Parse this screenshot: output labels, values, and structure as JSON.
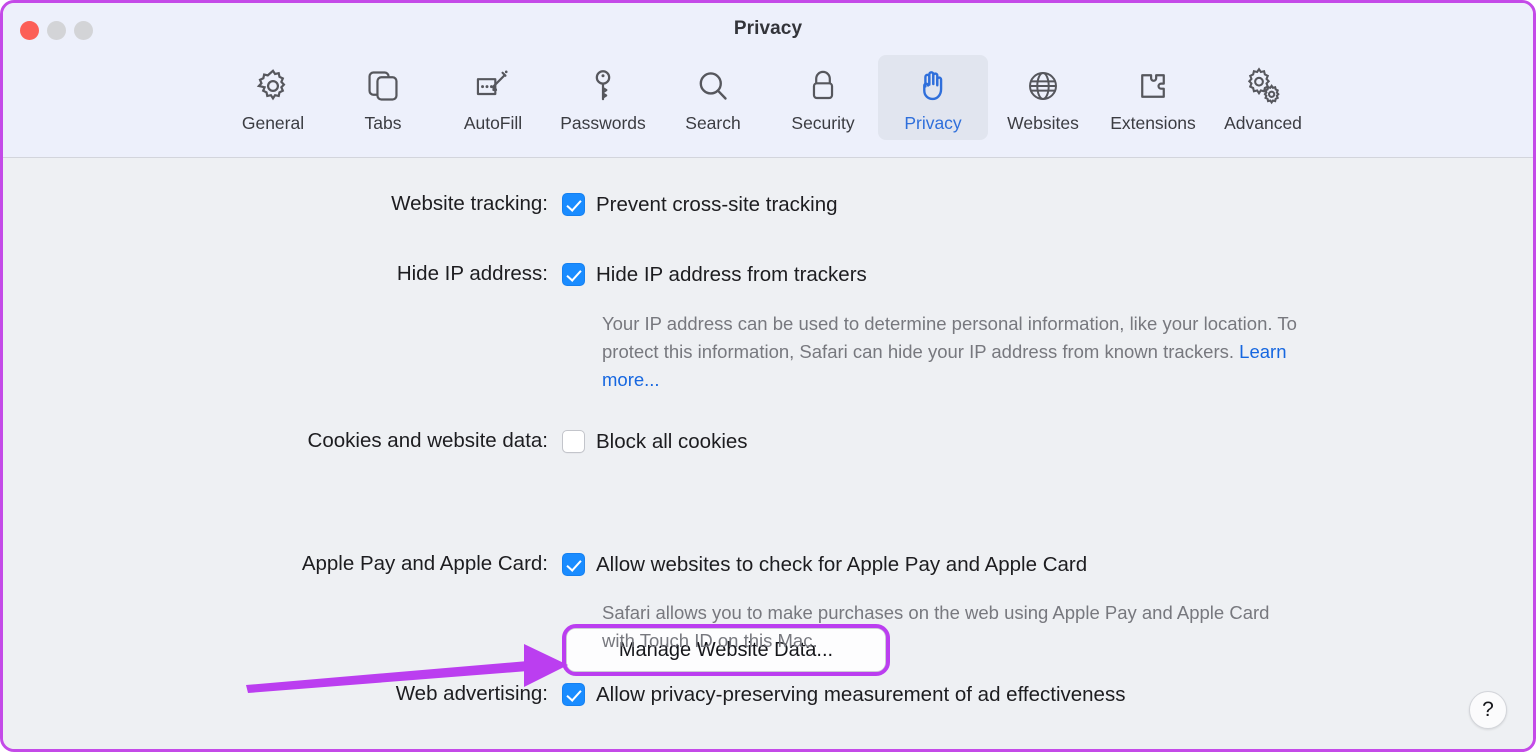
{
  "window": {
    "title": "Privacy",
    "traffic_lights": [
      {
        "name": "close",
        "color": "#fc5f57"
      },
      {
        "name": "minimize",
        "color": "#d3d4d7"
      },
      {
        "name": "zoom",
        "color": "#d3d4d7"
      }
    ],
    "highlight_color": "#c44ae8"
  },
  "toolbar": {
    "tabs": [
      {
        "label": "General",
        "icon": "gear-icon",
        "selected": false
      },
      {
        "label": "Tabs",
        "icon": "tabs-icon",
        "selected": false
      },
      {
        "label": "AutoFill",
        "icon": "autofill-icon",
        "selected": false
      },
      {
        "label": "Passwords",
        "icon": "key-icon",
        "selected": false
      },
      {
        "label": "Search",
        "icon": "search-icon",
        "selected": false
      },
      {
        "label": "Security",
        "icon": "lock-icon",
        "selected": false
      },
      {
        "label": "Privacy",
        "icon": "hand-icon",
        "selected": true
      },
      {
        "label": "Websites",
        "icon": "globe-icon",
        "selected": false
      },
      {
        "label": "Extensions",
        "icon": "puzzle-icon",
        "selected": false
      },
      {
        "label": "Advanced",
        "icon": "gears-icon",
        "selected": false
      }
    ],
    "selected_tab": "Privacy",
    "accent_color": "#2f6fdb"
  },
  "settings": {
    "website_tracking": {
      "label": "Website tracking:",
      "checkbox_label": "Prevent cross-site tracking",
      "checked": true
    },
    "hide_ip": {
      "label": "Hide IP address:",
      "checkbox_label": "Hide IP address from trackers",
      "checked": true,
      "description": "Your IP address can be used to determine personal information, like your location. To protect this information, Safari can hide your IP address from known trackers. ",
      "link_text": "Learn more..."
    },
    "cookies": {
      "label": "Cookies and website data:",
      "checkbox_label": "Block all cookies",
      "checked": false,
      "button_label": "Manage Website Data..."
    },
    "apple_pay": {
      "label": "Apple Pay and Apple Card:",
      "checkbox_label": "Allow websites to check for Apple Pay and Apple Card",
      "checked": true,
      "description": "Safari allows you to make purchases on the web using Apple Pay and Apple Card with Touch ID on this Mac."
    },
    "web_advertising": {
      "label": "Web advertising:",
      "checkbox_label": "Allow privacy-preserving measurement of ad effectiveness",
      "checked": true
    }
  },
  "annotation": {
    "type": "arrow",
    "color": "#bb3ef0",
    "points_to": "Manage Website Data..."
  },
  "help": {
    "label": "?"
  }
}
